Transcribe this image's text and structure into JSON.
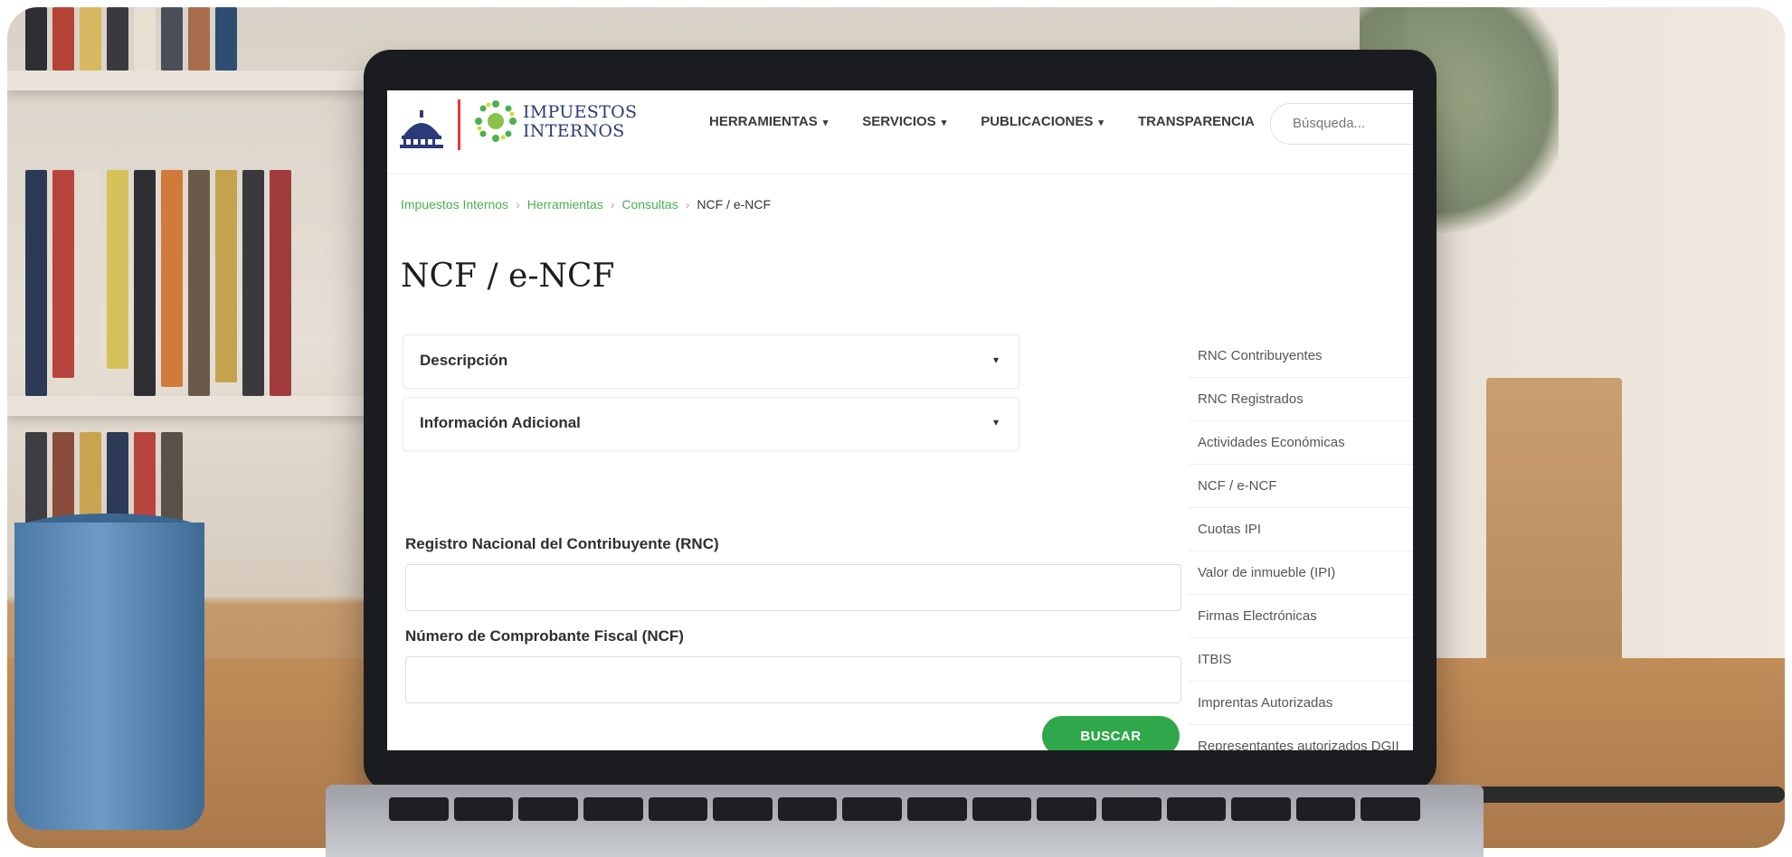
{
  "site": {
    "logo_line1": "IMPUESTOS",
    "logo_line2": "INTERNOS",
    "brand_color": "#2a3b78",
    "accent_color": "#2ea84a"
  },
  "nav": {
    "items": [
      {
        "label": "HERRAMIENTAS",
        "has_caret": true
      },
      {
        "label": "SERVICIOS",
        "has_caret": true
      },
      {
        "label": "PUBLICACIONES",
        "has_caret": true
      },
      {
        "label": "TRANSPARENCIA",
        "has_caret": false
      }
    ],
    "caret": "▾",
    "search_placeholder": "Búsqueda...",
    "search_value": ""
  },
  "breadcrumb": {
    "items": [
      "Impuestos Internos",
      "Herramientas",
      "Consultas"
    ],
    "current": "NCF / e-NCF",
    "separator": "›"
  },
  "page": {
    "title": "NCF / e-NCF",
    "accordions": [
      {
        "label": "Descripción",
        "caret": "▾"
      },
      {
        "label": "Información Adicional",
        "caret": "▾"
      }
    ],
    "form": {
      "rnc_label": "Registro Nacional del Contribuyente (RNC)",
      "rnc_value": "",
      "ncf_label": "Número de Comprobante Fiscal (NCF)",
      "ncf_value": "",
      "submit_label": "BUSCAR"
    }
  },
  "sidebar": {
    "items": [
      "RNC Contribuyentes",
      "RNC Registrados",
      "Actividades Económicas",
      "NCF / e-NCF",
      "Cuotas IPI",
      "Valor de inmueble (IPI)",
      "Firmas Electrónicas",
      "ITBIS",
      "Imprentas Autorizadas",
      "Representantes autorizados DGII"
    ]
  }
}
